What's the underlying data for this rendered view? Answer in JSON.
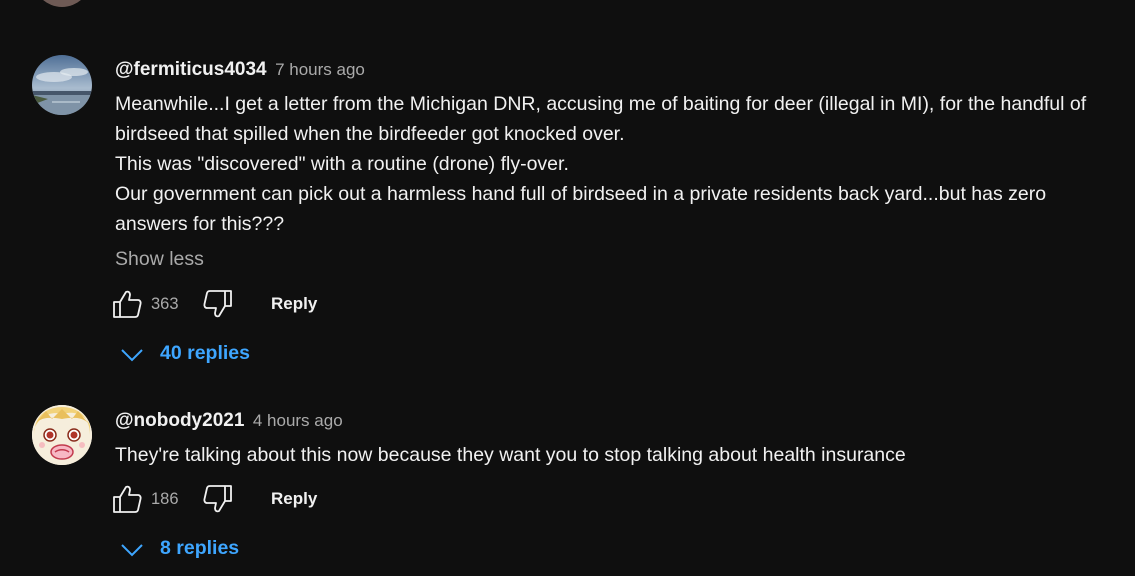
{
  "comments": [
    {
      "author": "@fermiticus4034",
      "time": "7 hours ago",
      "lines": [
        "Meanwhile...I get a letter from the Michigan DNR, accusing me of baiting for deer (illegal in MI), for the handful of birdseed that spilled when the birdfeeder got knocked over.",
        "This was \"discovered\" with a routine (drone) fly-over.",
        "Our government can pick out a harmless hand full of birdseed in a private residents back yard...but has zero answers for this???"
      ],
      "show_less": "Show less",
      "likes": "363",
      "reply_label": "Reply",
      "replies_label": "40 replies",
      "avatar_icon": "landscape-avatar"
    },
    {
      "author": "@nobody2021",
      "time": "4 hours ago",
      "lines": [
        "They're talking about this now because they want you to stop talking about health insurance"
      ],
      "likes": "186",
      "reply_label": "Reply",
      "replies_label": "8 replies",
      "avatar_icon": "anime-avatar"
    }
  ],
  "colors": {
    "background": "#0f0f0f",
    "text": "#f1f1f1",
    "secondary": "#aaaaaa",
    "link": "#3ea6ff"
  }
}
